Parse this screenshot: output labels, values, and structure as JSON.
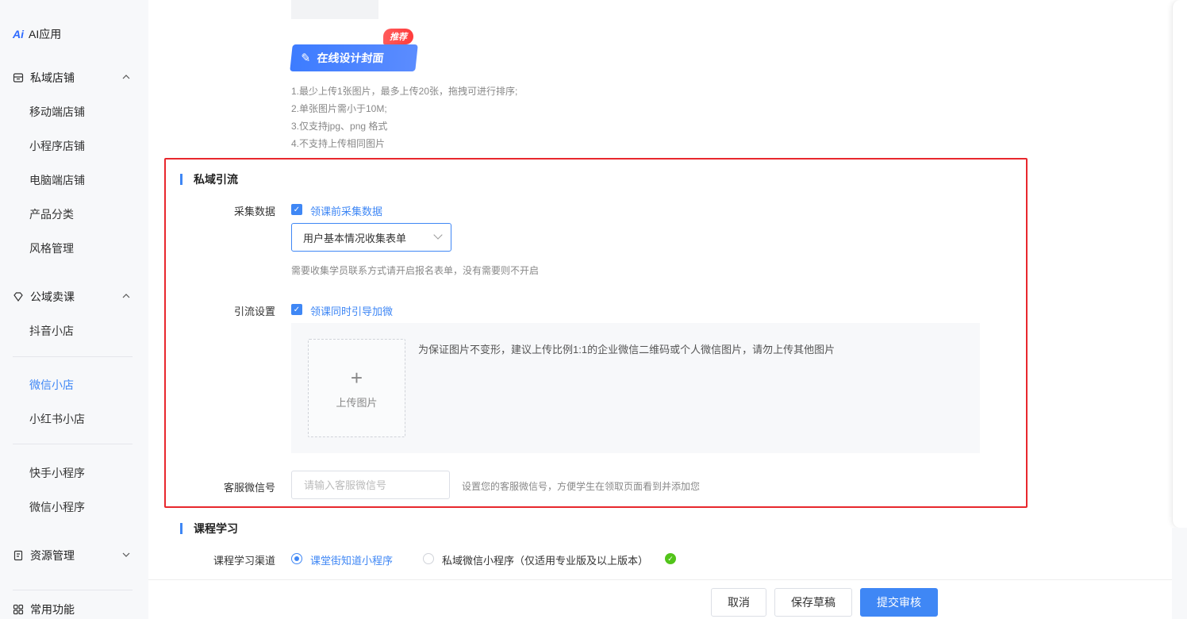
{
  "sidebar": {
    "ai_app": {
      "mark": "Ai",
      "label": "AI应用"
    },
    "groups": {
      "private_store": "私域店铺",
      "public_sales": "公域卖课",
      "resources": "资源管理",
      "common": "常用功能"
    },
    "items": {
      "mobile_store": "移动端店铺",
      "mini_program_store": "小程序店铺",
      "pc_store": "电脑端店铺",
      "product_category": "产品分类",
      "style_manage": "风格管理",
      "douyin_store": "抖音小店",
      "wechat_store": "微信小店",
      "xiaohongshu_store": "小红书小店",
      "kuaishou_mini": "快手小程序",
      "wechat_mini": "微信小程序"
    },
    "active": "微信小店"
  },
  "cover": {
    "design_button": "在线设计封面",
    "recommend_badge": "推荐",
    "tips": [
      "1.最少上传1张图片，最多上传20张，拖拽可进行排序;",
      "2.单张图片需小于10M;",
      "3.仅支持jpg、png 格式",
      "4.不支持上传相同图片"
    ]
  },
  "private_traffic": {
    "title": "私域引流",
    "collect": {
      "label": "采集数据",
      "checkbox_label": "领课前采集数据",
      "checked": true,
      "select_value": "用户基本情况收集表单",
      "hint": "需要收集学员联系方式请开启报名表单，没有需要则不开启"
    },
    "guide": {
      "label": "引流设置",
      "checkbox_label": "领课同时引导加微",
      "checked": true,
      "upload_label": "上传图片",
      "upload_desc": "为保证图片不变形，建议上传比例1:1的企业微信二维码或个人微信图片，请勿上传其他图片"
    },
    "service_wechat": {
      "label": "客服微信号",
      "placeholder": "请输入客服微信号",
      "value": "",
      "hint": "设置您的客服微信号，方便学生在领取页面看到并添加您"
    }
  },
  "course_learning": {
    "title": "课程学习",
    "channel_label": "课程学习渠道",
    "options": [
      {
        "label": "课堂街知道小程序",
        "selected": true
      },
      {
        "label": "私域微信小程序（仅适用专业版及以上版本）",
        "selected": false
      }
    ]
  },
  "footer": {
    "cancel": "取消",
    "save_draft": "保存草稿",
    "submit": "提交审核"
  },
  "colors": {
    "accent": "#3f87f5",
    "highlight_border": "#e8272d",
    "success": "#52c41a"
  }
}
